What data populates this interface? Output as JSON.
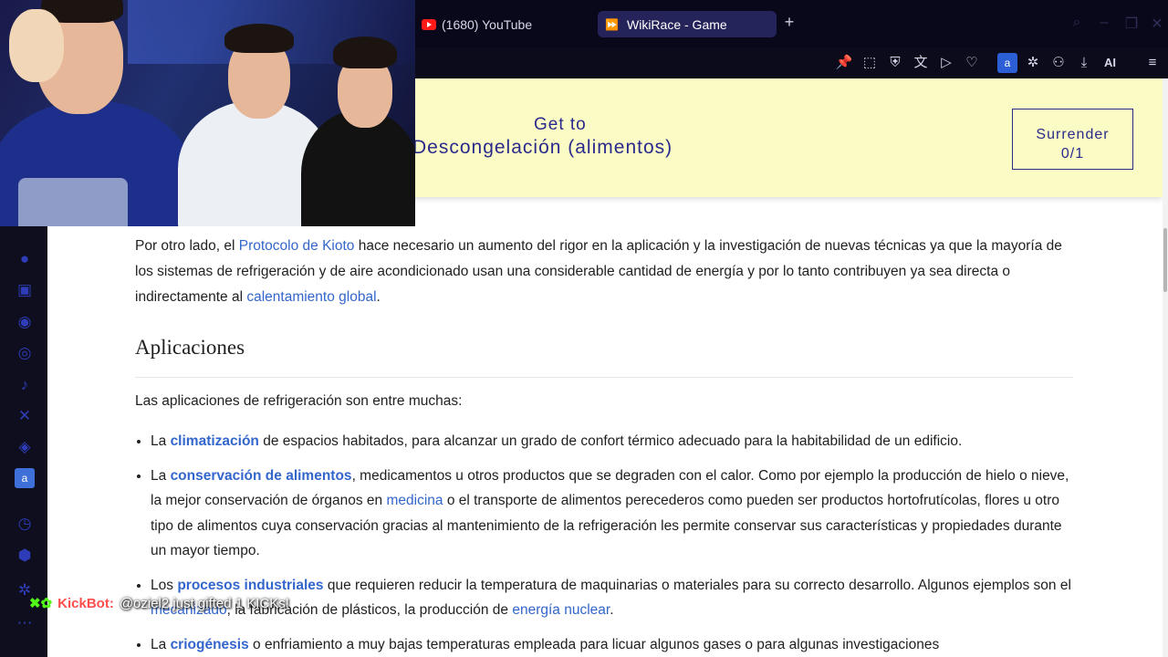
{
  "browser": {
    "tabs": [
      {
        "label": "(1680) YouTube"
      },
      {
        "label": "WikiRace - Game"
      }
    ],
    "new_tab": "+",
    "toolbar_ai": "AI"
  },
  "game": {
    "goal_label": "Get to",
    "goal_target": "Descongelación (alimentos)",
    "surrender_label": "Surrender",
    "surrender_count": "0/1"
  },
  "article": {
    "para1": {
      "t1": "Por otro lado, el ",
      "link1": "Protocolo de Kioto",
      "t2": " hace necesario un aumento del rigor en la aplicación y la investigación de nuevas técnicas ya que la mayoría de los sistemas de refrigeración y de aire acondicionado usan una considerable cantidad de energía y por lo tanto contribuyen ya sea directa o indirectamente al ",
      "link2": "calentamiento global",
      "t3": "."
    },
    "heading": "Aplicaciones",
    "intro": "Las aplicaciones de refrigeración son entre muchas:",
    "items": [
      {
        "pre": "La ",
        "link": "climatización",
        "post": " de espacios habitados, para alcanzar un grado de confort térmico adecuado para la habitabilidad de un edificio."
      },
      {
        "pre": "La ",
        "link": "conservación de alimentos",
        "mid": ", medicamentos u otros productos que se degraden con el calor. Como por ejemplo la producción de hielo o nieve, la mejor conservación de órganos en ",
        "link2": "medicina",
        "post": " o el transporte de alimentos perecederos como pueden ser productos hortofrutícolas, flores u otro tipo de alimentos cuya conservación gracias al mantenimiento de la refrigeración les permite conservar sus características y propiedades durante un mayor tiempo."
      },
      {
        "pre": "Los ",
        "link": "procesos industriales",
        "mid": " que requieren reducir la temperatura de maquinarias o materiales para su correcto desarrollo. Algunos ejemplos son el ",
        "link2": "mecanizado",
        "mid2": ", la fabricación de plásticos, la producción de ",
        "link3": "energía nuclear",
        "post": "."
      },
      {
        "pre": "La ",
        "link": "criogénesis",
        "post": " o enfriamiento a muy bajas temperaturas empleada para licuar algunos gases o para algunas investigaciones"
      }
    ]
  },
  "chat": {
    "bot_name": "KickBot:",
    "message": "@oziel2 just gifted 1 KICKs!"
  },
  "colors": {
    "banner_bg": "#fbfbc5",
    "banner_text": "#2a2a8c",
    "link": "#3366cc",
    "active_tab": "#24245a"
  }
}
